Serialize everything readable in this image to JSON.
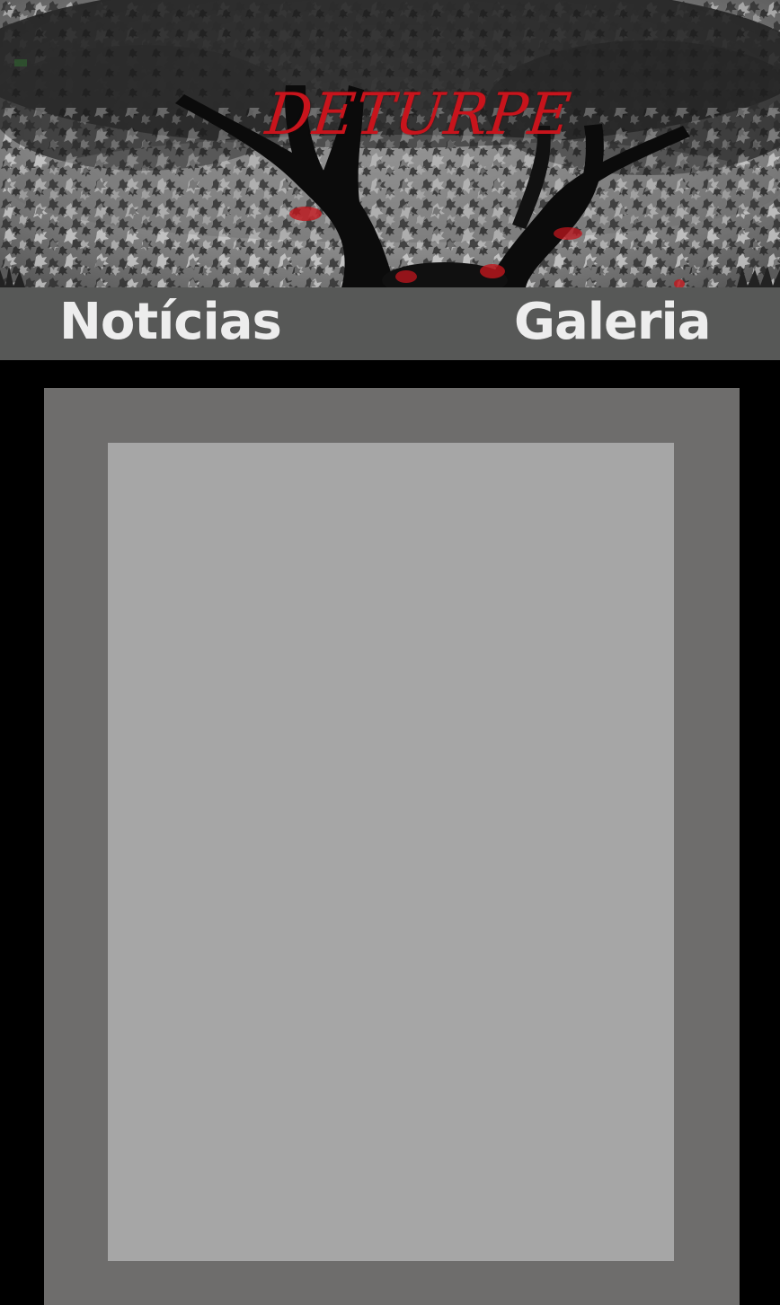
{
  "header": {
    "logo_text": "DETURPE"
  },
  "nav": {
    "items": [
      {
        "label": "Notícias"
      },
      {
        "label": "Galeria"
      }
    ]
  },
  "colors": {
    "page_background": "#000000",
    "nav_background": "#575857",
    "nav_text": "#ededed",
    "logo_red": "#c8141c",
    "panel_outer": "#6e6d6c",
    "panel_inner": "#a6a6a6"
  }
}
